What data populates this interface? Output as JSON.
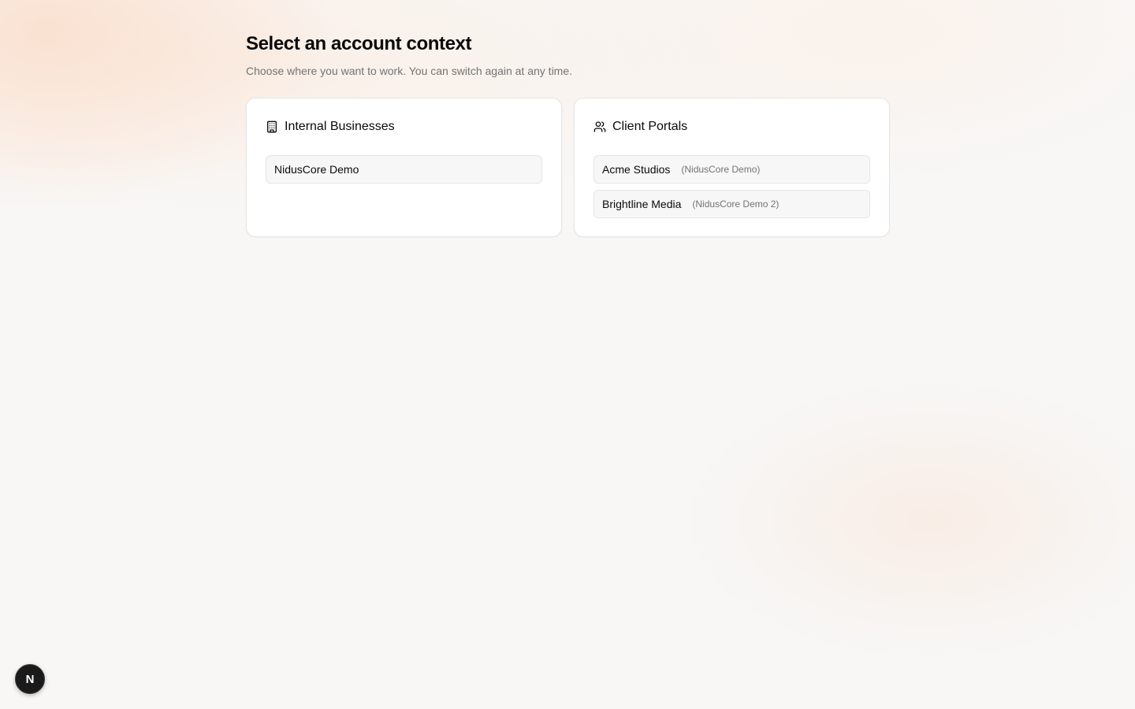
{
  "page": {
    "title": "Select an account context",
    "subtitle": "Choose where you want to work. You can switch again at any time."
  },
  "internal": {
    "title": "Internal Businesses",
    "icon": "building-icon",
    "items": [
      {
        "name": "NidusCore Demo"
      }
    ]
  },
  "client": {
    "title": "Client Portals",
    "icon": "users-icon",
    "items": [
      {
        "name": "Acme Studios",
        "parent": "(NidusCore Demo)"
      },
      {
        "name": "Brightline Media",
        "parent": "(NidusCore Demo 2)"
      }
    ]
  },
  "dev_badge": {
    "letter": "N",
    "icon": "nextjs-icon"
  },
  "colors": {
    "text_primary": "#0a0a0a",
    "text_muted": "#737373",
    "card_bg": "#ffffff",
    "item_bg": "#f7f7f7",
    "border": "#e5e5e5",
    "badge_bg": "#1a1a1a"
  }
}
